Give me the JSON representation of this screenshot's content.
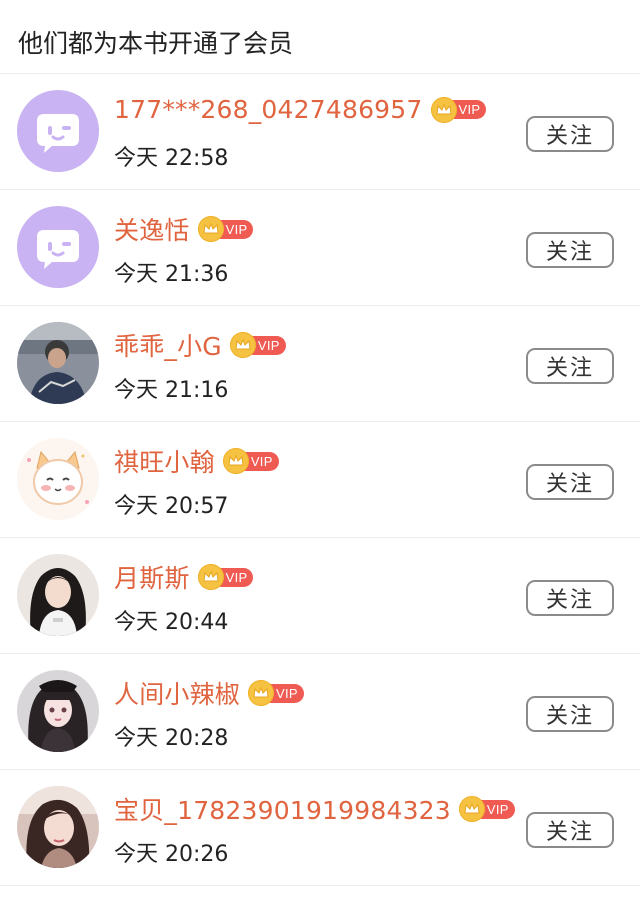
{
  "header": {
    "title": "他们都为本书开通了会员"
  },
  "members": [
    {
      "name": "177***268_0427486957",
      "time": "今天 22:58",
      "avatar": "default-chat-avatar",
      "vip_label": "VIP",
      "follow_label": "关注"
    },
    {
      "name": "关逸恬",
      "time": "今天 21:36",
      "avatar": "default-chat-avatar",
      "vip_label": "VIP",
      "follow_label": "关注"
    },
    {
      "name": "乖乖_小G",
      "time": "今天 21:16",
      "avatar": "photo-avatar",
      "vip_label": "VIP",
      "follow_label": "关注"
    },
    {
      "name": "祺旺小翰",
      "time": "今天 20:57",
      "avatar": "cartoon-cat-avatar",
      "vip_label": "VIP",
      "follow_label": "关注"
    },
    {
      "name": "月斯斯",
      "time": "今天 20:44",
      "avatar": "photo-avatar",
      "vip_label": "VIP",
      "follow_label": "关注"
    },
    {
      "name": "人间小辣椒",
      "time": "今天 20:28",
      "avatar": "illustrated-girl-avatar",
      "vip_label": "VIP",
      "follow_label": "关注"
    },
    {
      "name": "宝贝_17823901919984323",
      "time": "今天 20:26",
      "avatar": "photo-avatar",
      "vip_label": "VIP",
      "follow_label": "关注"
    }
  ],
  "colors": {
    "name": "#e0643f",
    "vip_tag": "#ef5b52",
    "vip_crown": "#f6c242",
    "default_avatar": "#c9b3f2"
  }
}
